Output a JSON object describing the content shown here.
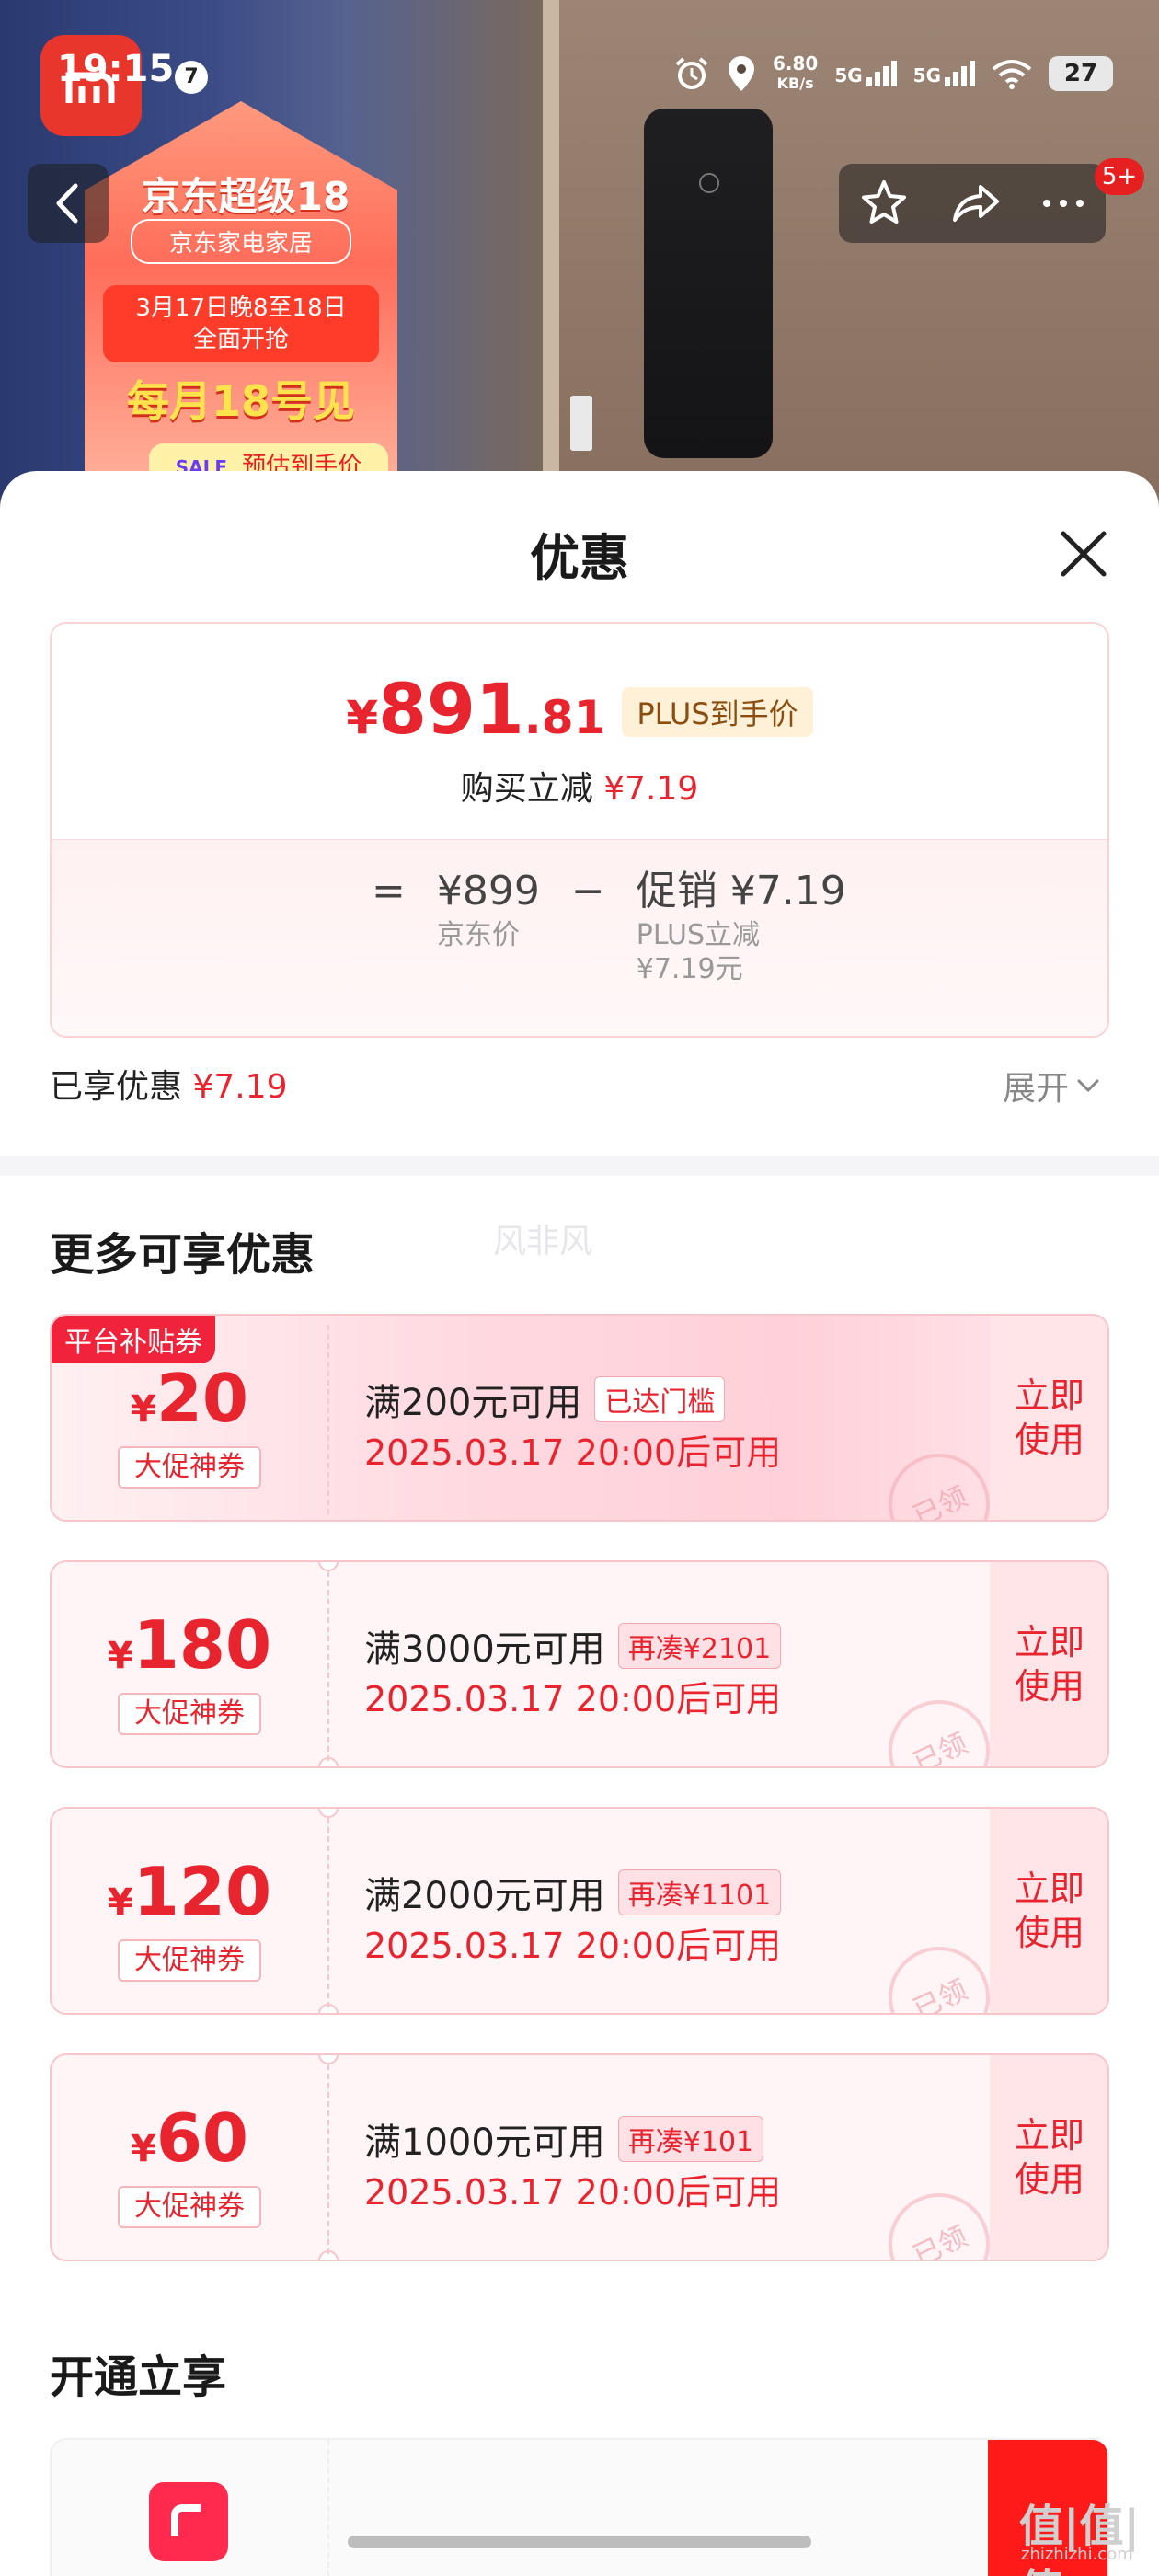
{
  "status_bar": {
    "time": "19:15",
    "notification_count": "7",
    "net_speed_value": "6.80",
    "net_speed_unit": "KB/s",
    "sig1": "5G",
    "sig2": "5G",
    "battery": "27",
    "app_icon": "mi-logo-icon"
  },
  "poster": {
    "title": "京东超级18",
    "sub": "京东家电家居",
    "date_line1": "3月17日晚8至18日",
    "date_line2": "全面开抢",
    "big": "每月18号见",
    "small": "预估到手价",
    "badge": "SALE"
  },
  "nav": {
    "message_badge": "5+"
  },
  "sheet": {
    "title": "优惠",
    "price": {
      "symbol": "¥",
      "integer": "891",
      "decimal": ".81",
      "plus_tag": "PLUS到手价",
      "reduce_label": "购买立减",
      "reduce_value": "¥7.19"
    },
    "formula": {
      "eq": "=",
      "jd_price": "¥899",
      "jd_label": "京东价",
      "minus": "−",
      "promo": "促销 ¥7.19",
      "promo_label1": "PLUS立减",
      "promo_label2": "¥7.19元"
    },
    "enjoyed_label": "已享优惠",
    "enjoyed_value": "¥7.19",
    "expand_label": "展开"
  },
  "more": {
    "title": "更多可享优惠",
    "watermark": "风非风",
    "coupons": [
      {
        "platform_tag": "平台补贴券",
        "symbol": "¥",
        "amount": "20",
        "kind": "大促神券",
        "condition": "满200元可用",
        "tag": "已达门槛",
        "time": "2025.03.17 20:00后可用",
        "action_1": "立即",
        "action_2": "使用",
        "stamp": "已领"
      },
      {
        "symbol": "¥",
        "amount": "180",
        "kind": "大促神券",
        "condition": "满3000元可用",
        "tag": "再凑¥2101",
        "time": "2025.03.17 20:00后可用",
        "action_1": "立即",
        "action_2": "使用",
        "stamp": "已领"
      },
      {
        "symbol": "¥",
        "amount": "120",
        "kind": "大促神券",
        "condition": "满2000元可用",
        "tag": "再凑¥1101",
        "time": "2025.03.17 20:00后可用",
        "action_1": "立即",
        "action_2": "使用",
        "stamp": "已领"
      },
      {
        "symbol": "¥",
        "amount": "60",
        "kind": "大促神券",
        "condition": "满1000元可用",
        "tag": "再凑¥101",
        "time": "2025.03.17 20:00后可用",
        "action_1": "立即",
        "action_2": "使用",
        "stamp": "已领"
      }
    ]
  },
  "open_section": {
    "title": "开通立享"
  },
  "site_watermark": {
    "mark": "值|值|值",
    "url": "zhizhizhi.com"
  }
}
